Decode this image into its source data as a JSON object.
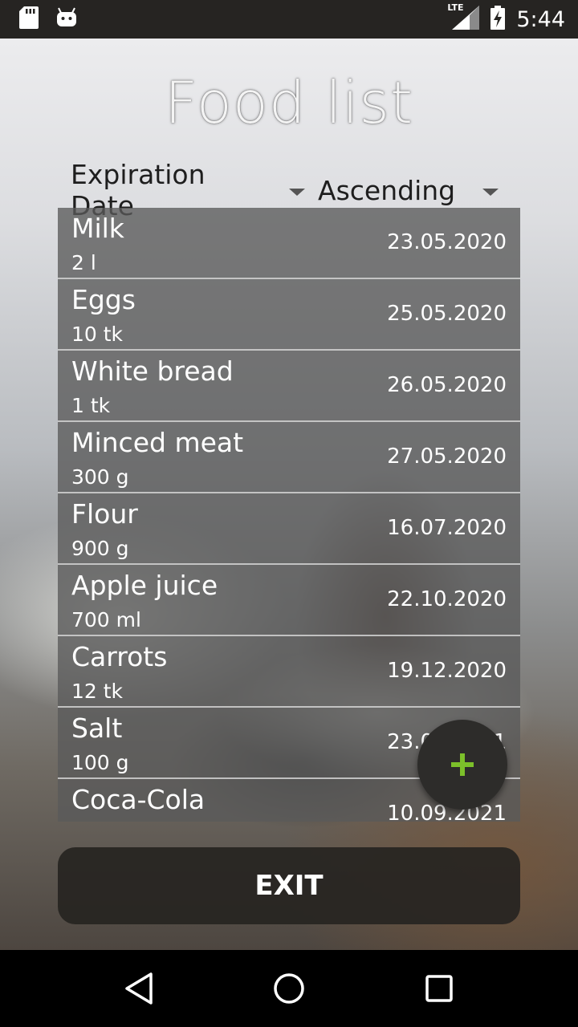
{
  "status_bar": {
    "time": "5:44",
    "network": "LTE",
    "icons": [
      "sd-card-icon",
      "android-icon",
      "signal-icon",
      "battery-charging-icon"
    ]
  },
  "title": "Food list",
  "sort": {
    "field": "Expiration Date",
    "order": "Ascending"
  },
  "items": [
    {
      "name": "Milk",
      "qty": "2 l",
      "date": "23.05.2020"
    },
    {
      "name": "Eggs",
      "qty": "10 tk",
      "date": "25.05.2020"
    },
    {
      "name": "White bread",
      "qty": "1 tk",
      "date": "26.05.2020"
    },
    {
      "name": "Minced meat",
      "qty": "300 g",
      "date": "27.05.2020"
    },
    {
      "name": "Flour",
      "qty": "900 g",
      "date": "16.07.2020"
    },
    {
      "name": "Apple juice",
      "qty": "700 ml",
      "date": "22.10.2020"
    },
    {
      "name": "Carrots",
      "qty": "12 tk",
      "date": "19.12.2020"
    },
    {
      "name": "Salt",
      "qty": "100 g",
      "date": "23.01.2021"
    },
    {
      "name": "Coca-Cola",
      "qty": "",
      "date": "10.09.2021"
    }
  ],
  "fab": {
    "icon": "plus-icon",
    "color": "#7cc02a"
  },
  "exit_label": "EXIT",
  "nav": {
    "icons": [
      "back-icon",
      "home-icon",
      "recents-icon"
    ]
  }
}
